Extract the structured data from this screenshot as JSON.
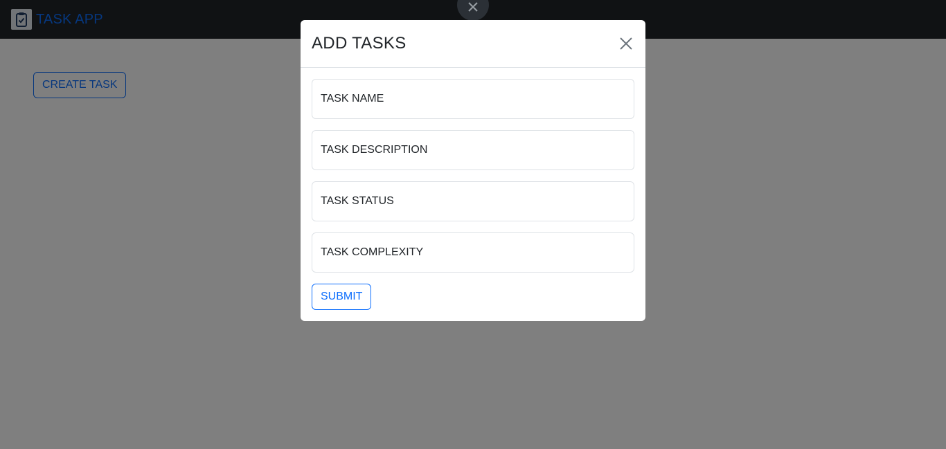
{
  "navbar": {
    "brand_text": "TASK APP",
    "brand_icon": "clipboard-check-icon"
  },
  "main": {
    "create_task_label": "CREATE TASK"
  },
  "modal": {
    "title": "ADD TASKS",
    "close_icon": "close-icon",
    "fields": [
      {
        "placeholder": "TASK NAME",
        "value": ""
      },
      {
        "placeholder": "TASK DESCRIPTION",
        "value": ""
      },
      {
        "placeholder": "TASK STATUS",
        "value": ""
      },
      {
        "placeholder": "TASK COMPLEXITY",
        "value": ""
      }
    ],
    "submit_label": "SUBMIT"
  },
  "colors": {
    "navbar_bg": "#212529",
    "primary": "#0d6efd",
    "backdrop": "rgba(0,0,0,0.5)"
  }
}
